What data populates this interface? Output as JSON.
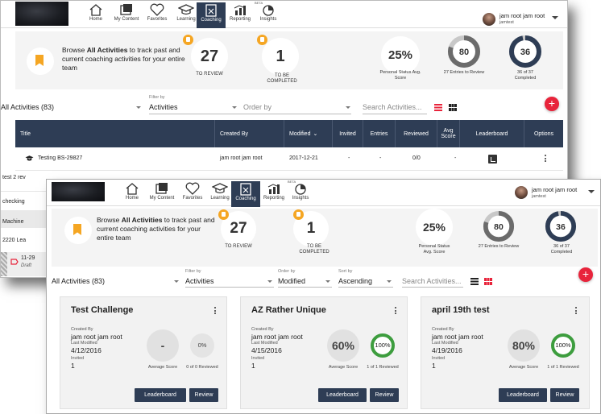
{
  "nav": {
    "items": [
      "Home",
      "My Content",
      "Favorites",
      "Learning",
      "Coaching",
      "Reporting",
      "Insights"
    ],
    "active": "Coaching",
    "beta": "BETA",
    "user_name": "jam root jam root",
    "user_sub": "jamtest"
  },
  "stats": {
    "browse_pre": "Browse ",
    "browse_bold": "All Activities",
    "browse_post": " to track past and current coaching activities for your entire team",
    "to_review_value": "27",
    "to_review_label": "TO REVIEW",
    "to_complete_value": "1",
    "to_complete_label": "TO BE COMPLETED",
    "personal_score": "25%",
    "personal_label": "Personal Status Avg. Score",
    "entries_value": "80",
    "entries_fraction": 0.8,
    "entries_label": "27 Entries to Review",
    "completed_value": "36",
    "completed_fraction": 0.97,
    "completed_label": "36 of 37 Completed"
  },
  "filters_back": {
    "activity": "All Activities (83)",
    "filter_label": "Filter by",
    "filter_value": "Activities",
    "order_value": "Order by",
    "search_placeholder": "Search Activities..."
  },
  "table": {
    "headers": [
      "Title",
      "Created By",
      "Modified",
      "Invited",
      "Entries",
      "Reviewed",
      "Avg Score",
      "Leaderboard",
      "Options"
    ],
    "rows": [
      {
        "title": "Testing BS-29827",
        "created_by": "jam root jam root",
        "modified": "2017-12-21",
        "invited": "-",
        "entries": "-",
        "reviewed": "0/0",
        "avg": "-"
      },
      {
        "title": "test 2 rev"
      },
      {
        "title": "checking"
      },
      {
        "title": "Machine"
      },
      {
        "title": "2220 Lea"
      },
      {
        "title": "11-29",
        "sub": "Draft"
      }
    ]
  },
  "filters_front": {
    "activity": "All Activities (83)",
    "filter_label": "Filter by",
    "filter_value": "Activities",
    "order_label": "Order by",
    "order_value": "Modified",
    "sort_label": "Sort by",
    "sort_value": "Ascending",
    "search_placeholder": "Search Activities..."
  },
  "cards": [
    {
      "title": "Test Challenge",
      "created_by_label": "Created By",
      "created_by": "jam root jam root",
      "modified_label": "Last Modified",
      "modified": "4/12/2016",
      "invited_label": "Invited",
      "invited": "1",
      "avg_score": "-",
      "avg_label": "Average Score",
      "reviewed_pct": "0%",
      "reviewed_label": "0 of 0 Reviewed",
      "leaderboard": "Leaderboard",
      "review": "Review"
    },
    {
      "title": "AZ Rather Unique",
      "created_by_label": "Created By",
      "created_by": "jam root jam root",
      "modified_label": "Last Modified",
      "modified": "4/15/2016",
      "invited_label": "Invited",
      "invited": "1",
      "avg_score": "60%",
      "avg_label": "Average Score",
      "reviewed_pct": "100%",
      "reviewed_label": "1 of 1 Reviewed",
      "leaderboard": "Leaderboard",
      "review": "Review"
    },
    {
      "title": "april 19th test",
      "created_by_label": "Created By",
      "created_by": "jam root jam root",
      "modified_label": "Last Modified",
      "modified": "4/19/2016",
      "invited_label": "Invited",
      "invited": "1",
      "avg_score": "80%",
      "avg_label": "Average Score",
      "reviewed_pct": "100%",
      "reviewed_label": "1 of 1 Reviewed",
      "leaderboard": "Leaderboard",
      "review": "Review"
    }
  ],
  "colors": {
    "navy": "#2e3d55",
    "accent_orange": "#f5a623",
    "add_red": "#e8243b",
    "ring_green": "#3d9d3e"
  }
}
